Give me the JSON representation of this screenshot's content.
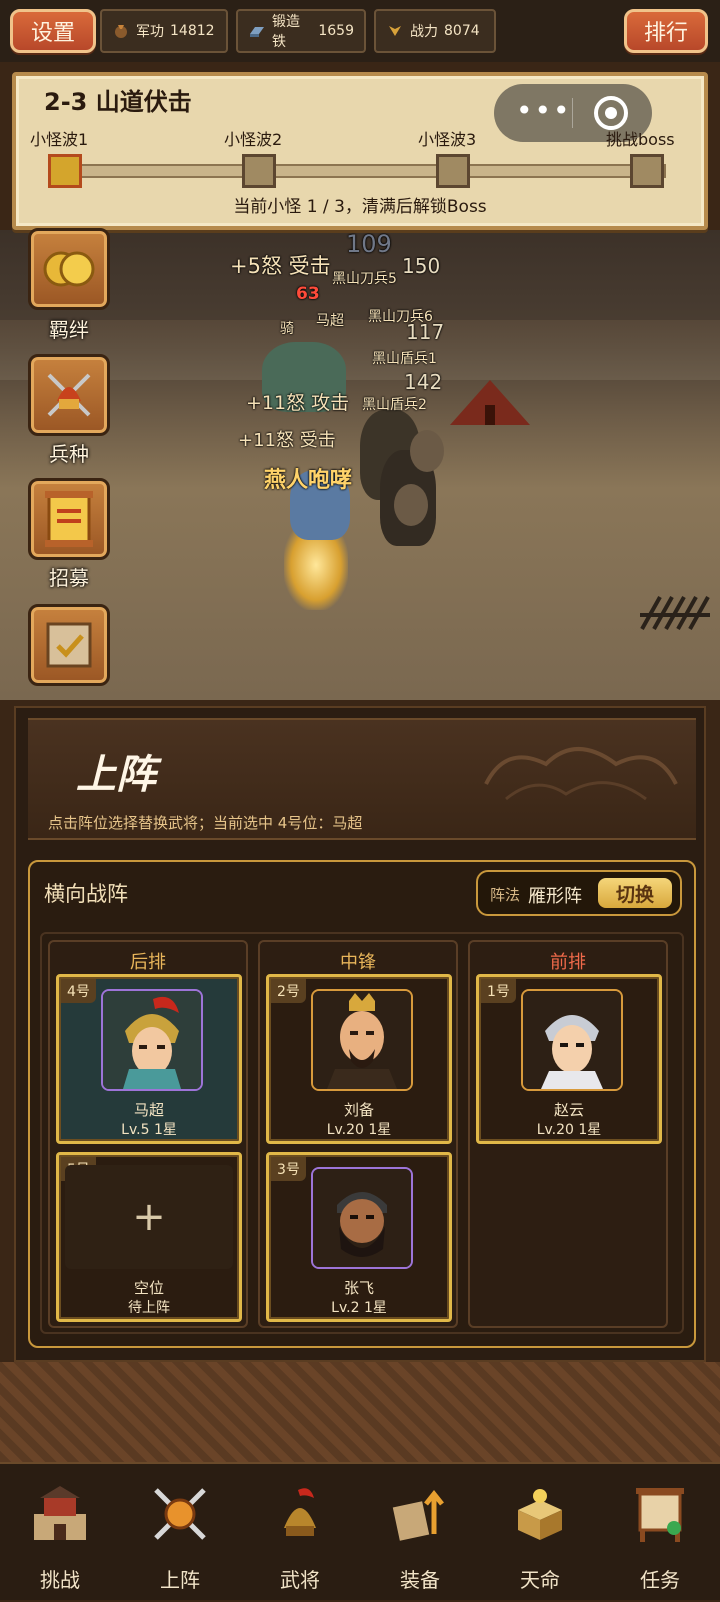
{
  "topbar": {
    "settings_label": "设置",
    "rank_label": "排行",
    "resources": [
      {
        "icon": "medal-icon",
        "label": "军功",
        "value": "14812"
      },
      {
        "icon": "iron-ingot-icon",
        "label": "锻造铁",
        "value": "1659"
      },
      {
        "icon": "power-icon",
        "label": "战力",
        "value": "8074"
      }
    ]
  },
  "stage": {
    "title": "2-3 山道伏击",
    "waves": [
      "小怪波1",
      "小怪波2",
      "小怪波3",
      "挑战boss"
    ],
    "progress_text": "当前小怪 1 / 3，清满后解锁Boss",
    "current_wave": 1,
    "total_waves": 3
  },
  "capsule": {
    "more_icon": "more-dots-icon",
    "close_icon": "target-circle-icon"
  },
  "side_menu": [
    {
      "label": "羁绊",
      "icon": "gold-rings-icon"
    },
    {
      "label": "兵种",
      "icon": "helmet-weapons-icon"
    },
    {
      "label": "招募",
      "icon": "recruit-scroll-icon"
    },
    {
      "label": "",
      "icon": "task-board-icon"
    }
  ],
  "battle": {
    "floats": [
      {
        "text": "+5怒 受击"
      },
      {
        "text": "109"
      },
      {
        "text": "150"
      },
      {
        "text": "黑山刀兵5"
      },
      {
        "text": "63"
      },
      {
        "text": "马超"
      },
      {
        "text": "黑山刀兵6"
      },
      {
        "text": "117"
      },
      {
        "text": "骑"
      },
      {
        "text": "黑山盾兵1"
      },
      {
        "text": "142"
      },
      {
        "text": "+11怒 攻击"
      },
      {
        "text": "黑山盾兵2"
      },
      {
        "text": "+11怒 受击"
      },
      {
        "text": "燕人咆哮"
      }
    ]
  },
  "lineup": {
    "title": "上阵",
    "hint": "点击阵位选择替换武将；当前选中 4号位：马超",
    "formation_box_title": "横向战阵",
    "formation_label": "阵法",
    "formation_value": "雁形阵",
    "switch_label": "切换",
    "columns": [
      {
        "title": "后排",
        "slots": [
          {
            "num": "4号",
            "name": "马超",
            "level": "Lv.5 1星",
            "selected": true
          },
          {
            "num": "5号",
            "name": "空位",
            "level": "待上阵",
            "empty": true
          }
        ]
      },
      {
        "title": "中锋",
        "slots": [
          {
            "num": "2号",
            "name": "刘备",
            "level": "Lv.20 1星"
          },
          {
            "num": "3号",
            "name": "张飞",
            "level": "Lv.2 1星"
          }
        ]
      },
      {
        "title": "前排",
        "slots": [
          {
            "num": "1号",
            "name": "赵云",
            "level": "Lv.20 1星"
          }
        ]
      }
    ]
  },
  "nav": [
    {
      "label": "挑战",
      "icon": "fortress-icon"
    },
    {
      "label": "上阵",
      "icon": "crossed-swords-shield-icon"
    },
    {
      "label": "武将",
      "icon": "general-helmet-icon"
    },
    {
      "label": "装备",
      "icon": "equipment-upgrade-icon"
    },
    {
      "label": "天命",
      "icon": "destiny-box-icon"
    },
    {
      "label": "任务",
      "icon": "quest-board-icon"
    }
  ]
}
